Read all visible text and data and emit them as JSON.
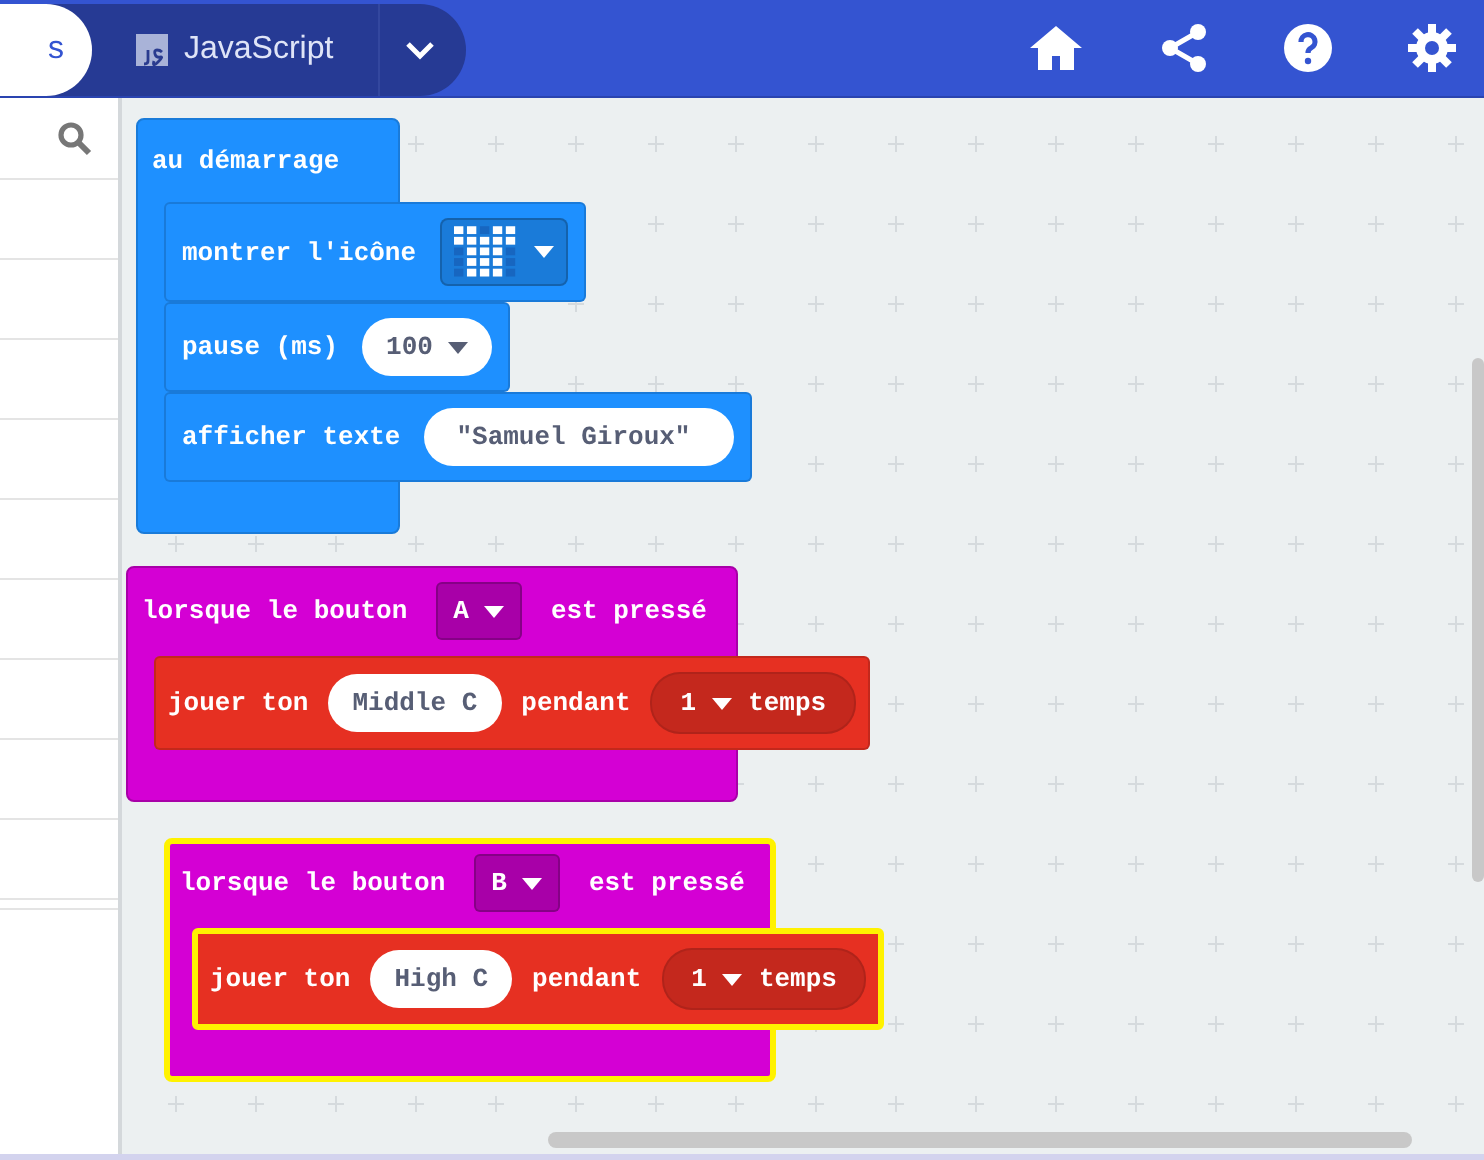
{
  "header": {
    "tabs": [
      {
        "label": "s",
        "selected": true
      },
      {
        "label": "JavaScript",
        "selected": false
      }
    ]
  },
  "workspace": {
    "blocks": [
      {
        "kind": "on_start",
        "label": "au démarrage",
        "selected": false,
        "statements": [
          {
            "kind": "show_icon",
            "label": "montrer l'icône"
          },
          {
            "kind": "pause",
            "label": "pause (ms)",
            "value": "100"
          },
          {
            "kind": "show_string",
            "label": "afficher  texte",
            "value": "\"Samuel Giroux\""
          }
        ]
      },
      {
        "kind": "on_button",
        "label": "lorsque le bouton",
        "button": "A",
        "suffix": "est pressé",
        "selected": false,
        "statements": [
          {
            "kind": "play_tone",
            "label": "jouer  ton",
            "note": "Middle C",
            "middle": "pendant",
            "beats": "1",
            "unit": "temps"
          }
        ]
      },
      {
        "kind": "on_button",
        "label": "lorsque le bouton",
        "button": "B",
        "suffix": "est pressé",
        "selected": true,
        "statements": [
          {
            "kind": "play_tone",
            "label": "jouer  ton",
            "note": "High C",
            "middle": "pendant",
            "beats": "1",
            "unit": "temps"
          }
        ]
      }
    ]
  }
}
